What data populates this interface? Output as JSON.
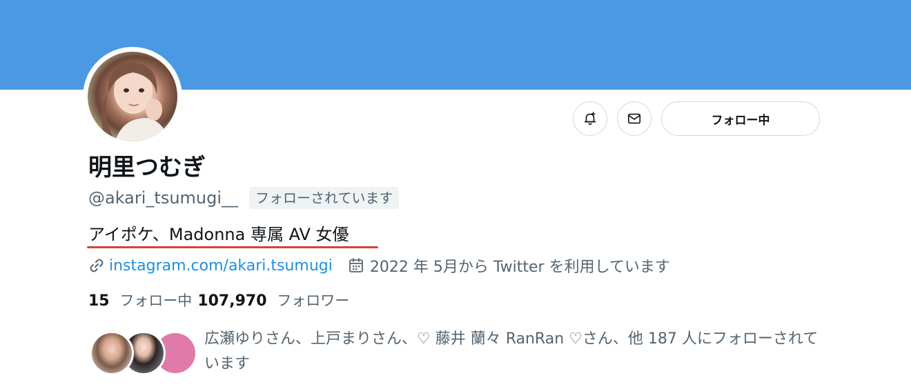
{
  "profile": {
    "display_name": "明里つむぎ",
    "handle": "@akari_tsumugi__",
    "follows_you_badge": "フォローされています",
    "bio": "アイポケ、Madonna 専属 AV 女優",
    "link_text": "instagram.com/akari.tsumugi",
    "joined_text": "2022 年 5月から Twitter を利用しています"
  },
  "actions": {
    "notifications_icon": "bell-plus-icon",
    "message_icon": "envelope-icon",
    "follow_button_label": "フォロー中"
  },
  "stats": {
    "following_count": "15",
    "following_label": "フォロー中",
    "followers_count": "107,970",
    "followers_label": "フォロワー"
  },
  "followers_you_know": {
    "text": "広瀬ゆりさん、上戸まりさん、♡ 藤井 蘭々 RanRan ♡さん、他 187 人にフォローされています"
  },
  "colors": {
    "banner": "#4a99e2",
    "link": "#1d8fe0",
    "underline_annotation": "#d9432f"
  }
}
